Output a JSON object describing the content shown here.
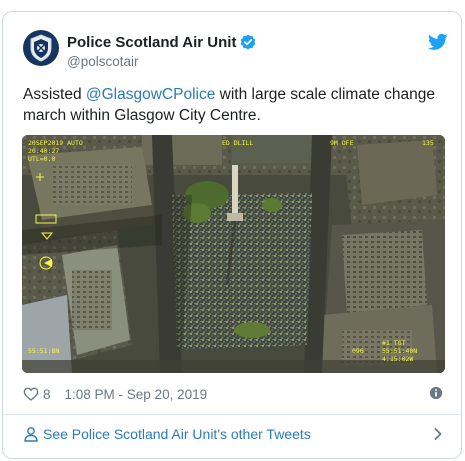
{
  "author": {
    "name": "Police Scotland Air Unit",
    "handle": "@polscotair",
    "avatar_icon": "police-scotland-crest-icon",
    "verified_icon": "verified-badge-icon"
  },
  "tweet": {
    "text_prefix": "Assisted ",
    "mention": "@GlasgowCPolice",
    "text_suffix": " with large scale climate change march within Glasgow City Centre."
  },
  "media": {
    "description_icon": "aerial-photo",
    "osd": {
      "top_left": "20SEP2019 AUTO",
      "top_center": "ED DLILL",
      "top_right": "9M OFE",
      "top_right2": "135",
      "bottom_right": "#1 TGT",
      "bottom_right2": "55:51:40N",
      "bottom_right3": "4:15:02W",
      "bottom_left": "55:51:8N",
      "bottom_mid": "096"
    }
  },
  "footer": {
    "likes": "8",
    "timestamp": "1:08 PM - Sep 20, 2019",
    "more_tweets": "See Police Scotland Air Unit's other Tweets"
  },
  "colors": {
    "link": "#2b7bb9",
    "twitter_blue": "#1da1f2",
    "muted": "#697882"
  }
}
